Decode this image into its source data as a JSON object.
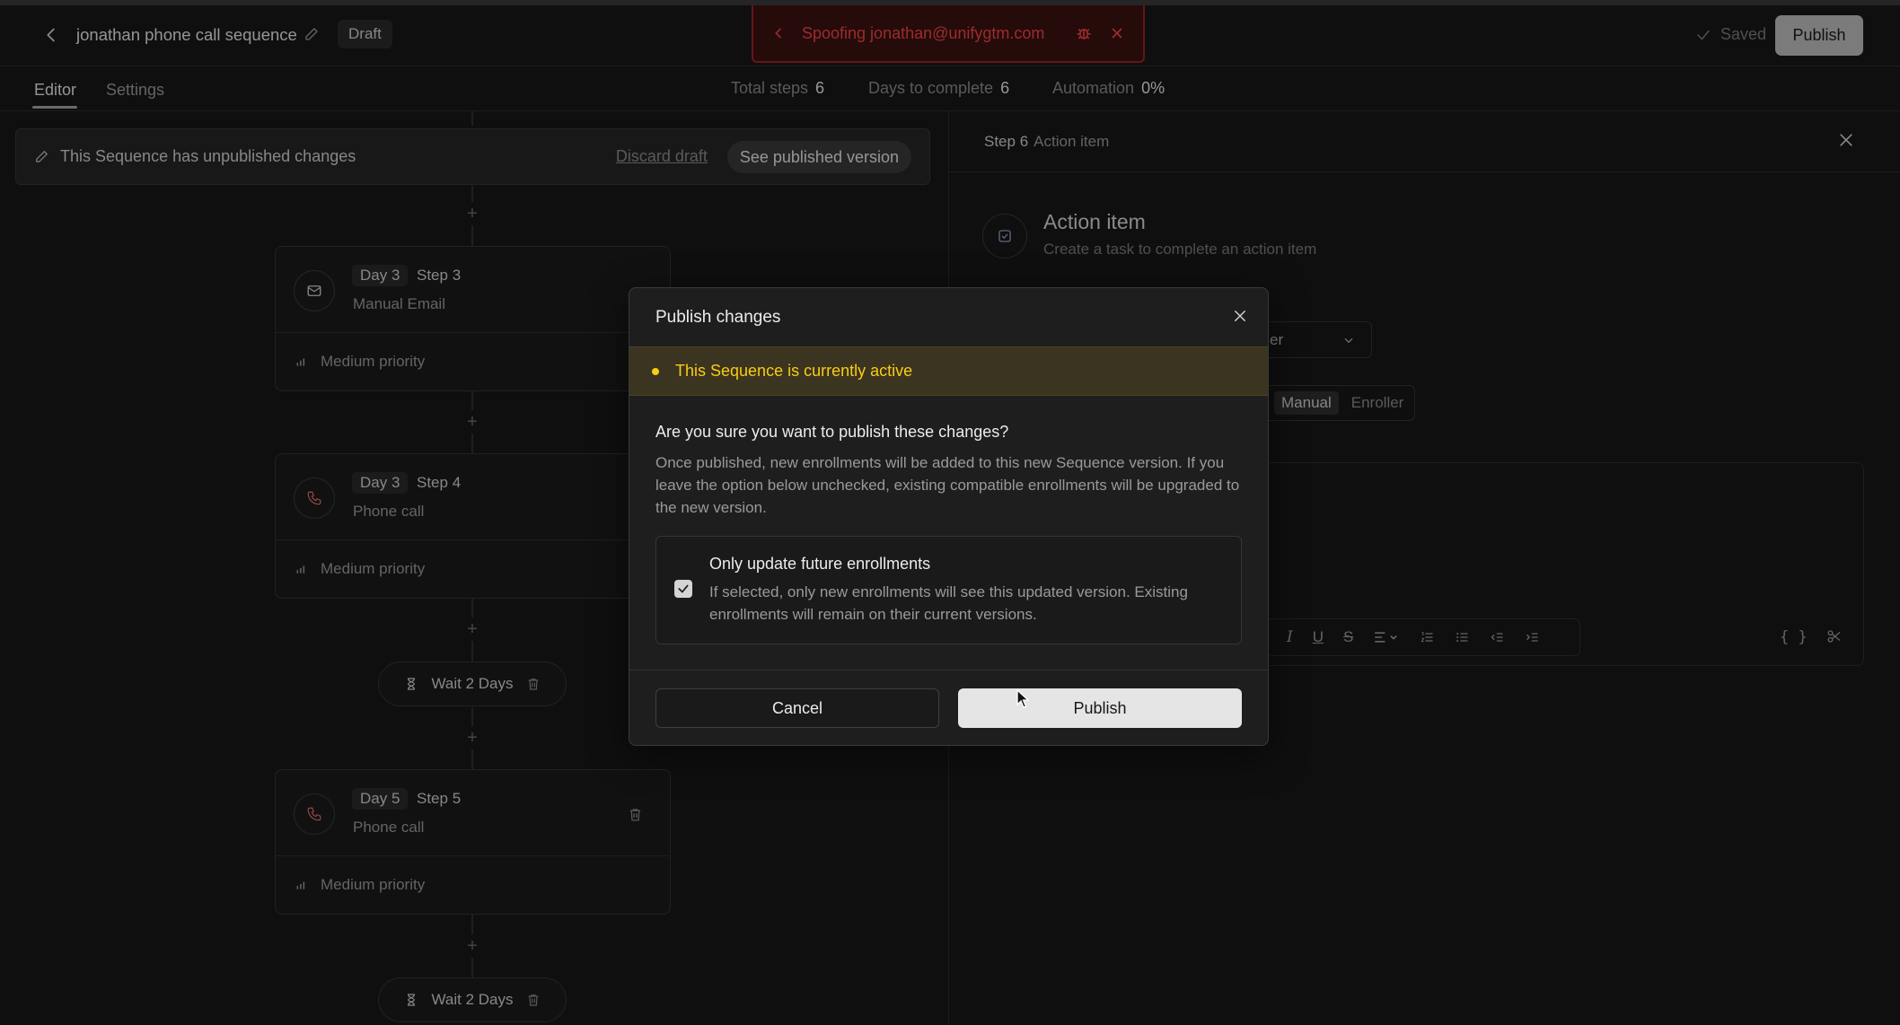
{
  "header": {
    "sequence_title": "jonathan phone call sequence",
    "status_badge": "Draft",
    "spoof_text": "Spoofing jonathan@unifygtm.com",
    "saved_label": "Saved",
    "publish_label": "Publish"
  },
  "tabs": [
    {
      "label": "Editor",
      "active": true
    },
    {
      "label": "Settings",
      "active": false
    }
  ],
  "stats": [
    {
      "label": "Total steps",
      "value": "6"
    },
    {
      "label": "Days to complete",
      "value": "6"
    },
    {
      "label": "Automation",
      "value": "0%"
    }
  ],
  "banner": {
    "message": "This Sequence has unpublished changes",
    "discard_label": "Discard draft",
    "see_published_label": "See published version"
  },
  "steps": [
    {
      "day": "Day 3",
      "step": "Step 3",
      "type": "Manual Email",
      "priority": "Medium priority",
      "icon": "mail-icon"
    },
    {
      "day": "Day 3",
      "step": "Step 4",
      "type": "Phone call",
      "priority": "Medium priority",
      "icon": "phone-icon"
    },
    {
      "day": "Day 5",
      "step": "Step 5",
      "type": "Phone call",
      "priority": "Medium priority",
      "icon": "phone-icon"
    }
  ],
  "waits": [
    {
      "label": "Wait 2 Days"
    },
    {
      "label": "Wait 2 Days"
    }
  ],
  "right_panel": {
    "step_label": "Step 6",
    "step_type": "Action item",
    "title": "Action item",
    "subtitle": "Create a task to complete an action item",
    "select_value": "er",
    "segment_on": "Manual",
    "segment_off": "Enroller",
    "braces": "{ }"
  },
  "modal": {
    "title": "Publish changes",
    "warning": "This Sequence is currently active",
    "question": "Are you sure you want to publish these changes?",
    "description": "Once published, new enrollments will be added to this new Sequence version. If you leave the option below unchecked, existing compatible enrollments will be upgraded to the new version.",
    "option_title": "Only update future enrollments",
    "option_desc": "If selected, only new enrollments will see this updated version. Existing enrollments will remain on their current versions.",
    "option_checked": true,
    "cancel_label": "Cancel",
    "publish_label": "Publish"
  },
  "colors": {
    "background": "#171717",
    "spoof_red": "#ef4444",
    "warning_yellow": "#facc15",
    "phone_icon_red": "#e0706a"
  }
}
